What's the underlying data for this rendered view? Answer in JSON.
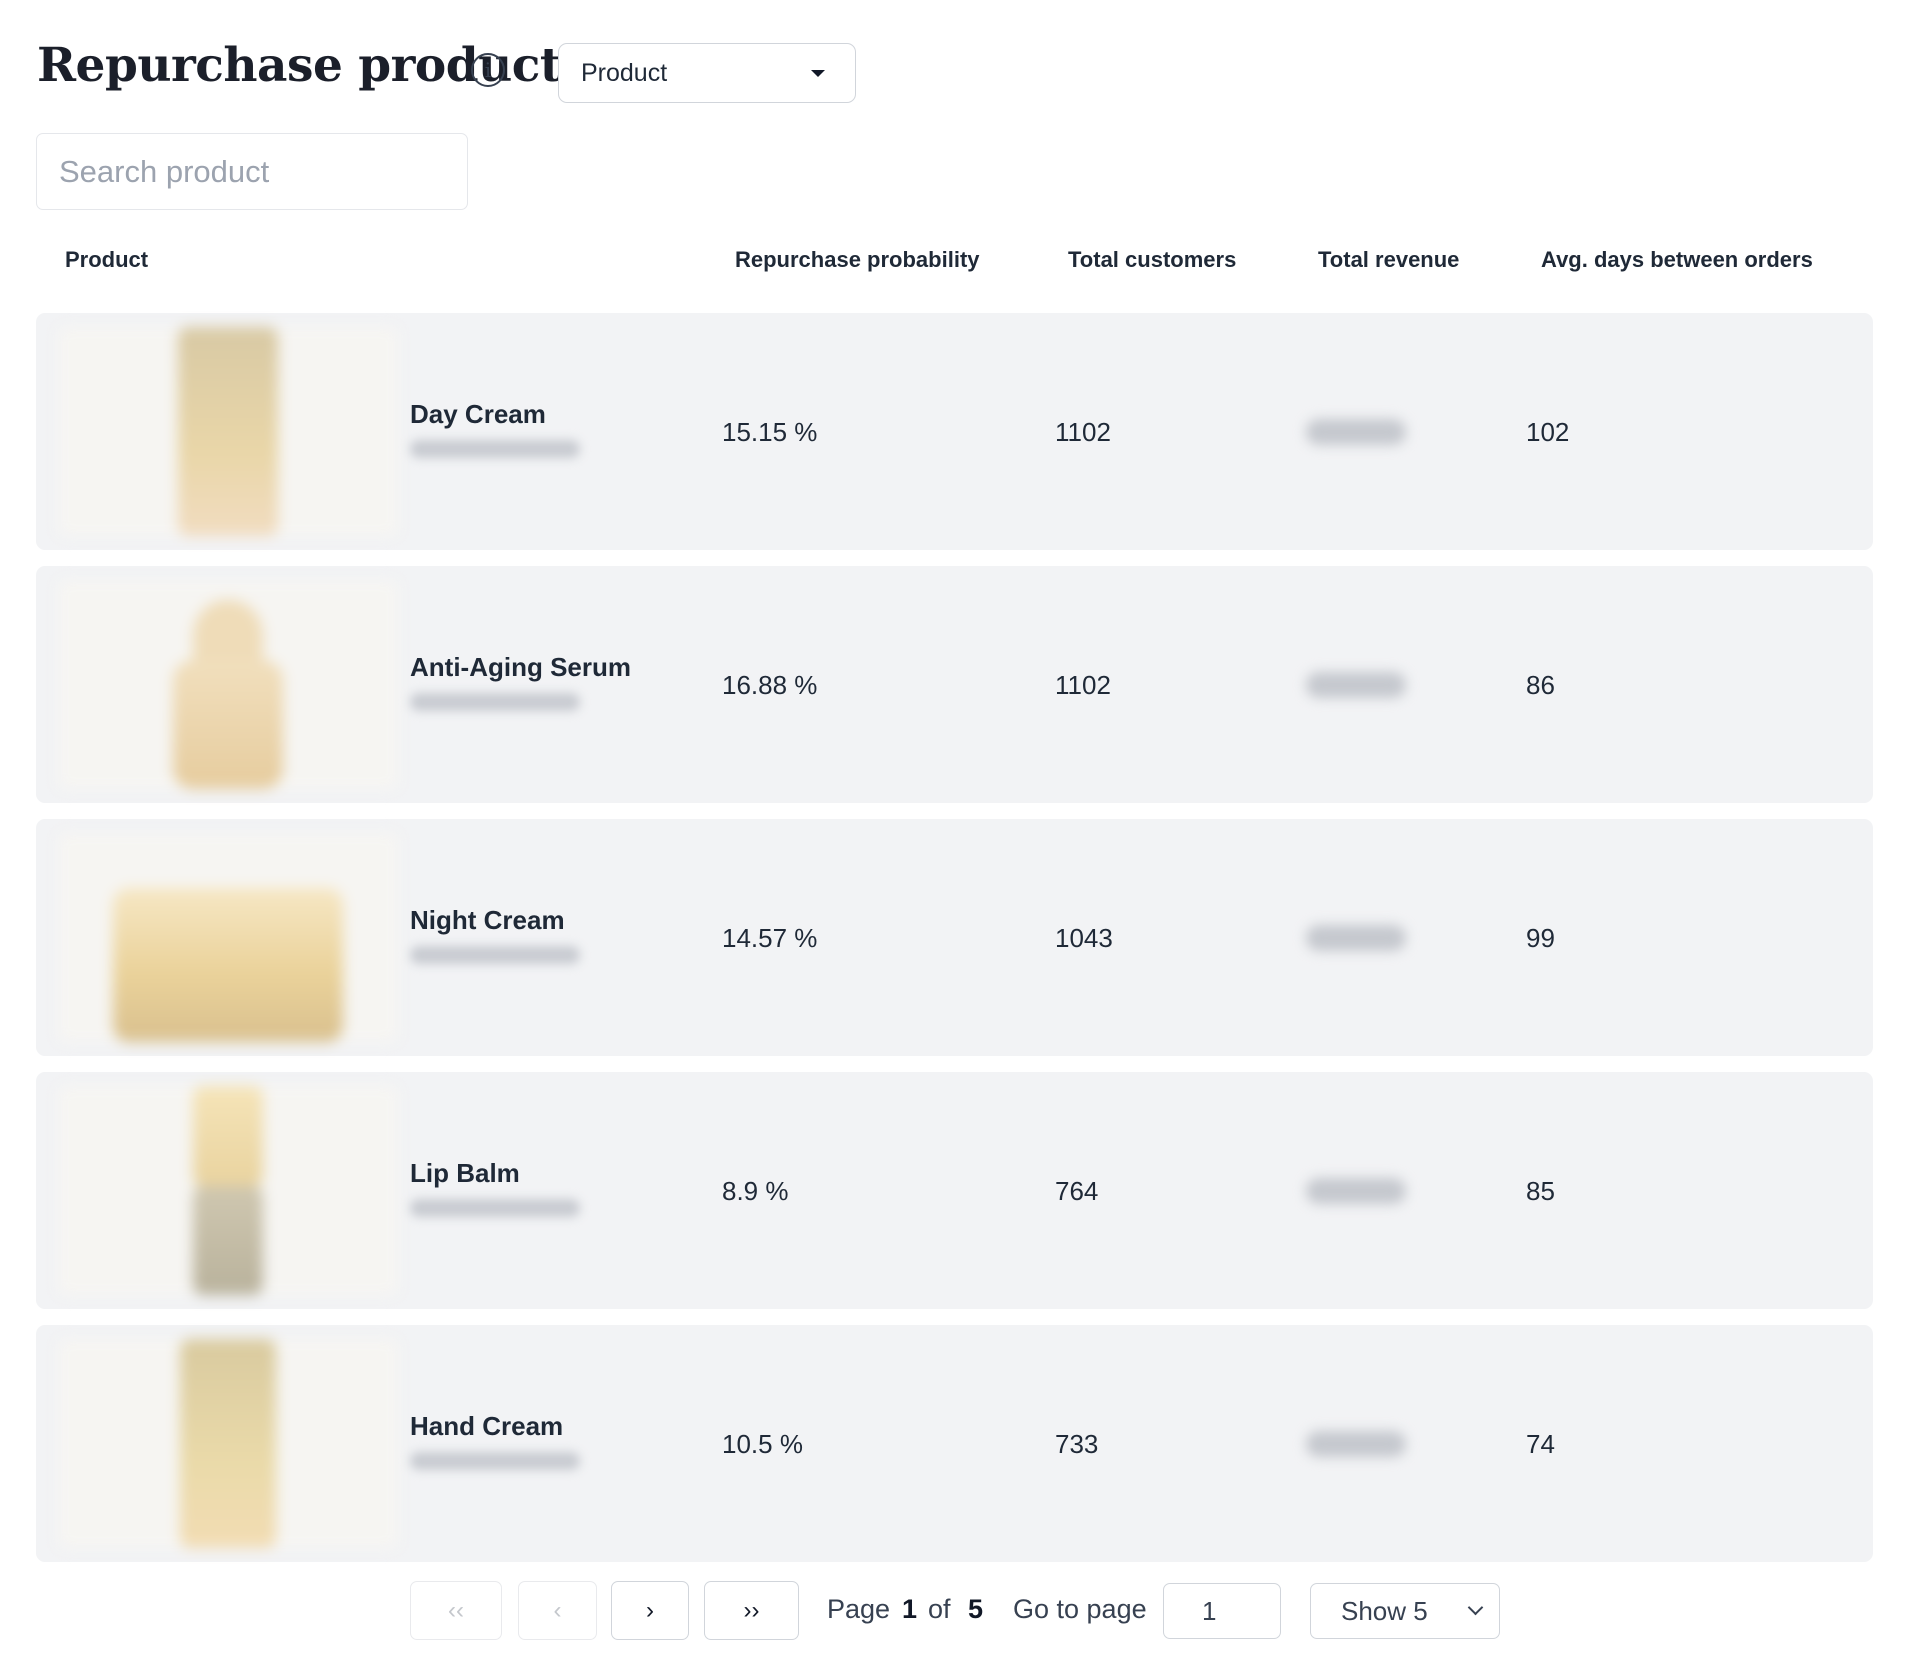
{
  "header": {
    "title": "Repurchase product",
    "info_icon_glyph": "i",
    "dropdown_value": "Product"
  },
  "search": {
    "placeholder": "Search product",
    "value": ""
  },
  "table": {
    "columns": {
      "product": "Product",
      "probability": "Repurchase probability",
      "customers": "Total customers",
      "revenue": "Total revenue",
      "avg_days": "Avg. days between orders"
    },
    "rows": [
      {
        "name": "Day Cream",
        "probability": "15.15 %",
        "customers": "1102",
        "avg_days": "102",
        "thumb_icon": "cream-tube-image"
      },
      {
        "name": "Anti-Aging Serum",
        "probability": "16.88 %",
        "customers": "1102",
        "avg_days": "86",
        "thumb_icon": "serum-bottle-image"
      },
      {
        "name": "Night Cream",
        "probability": "14.57 %",
        "customers": "1043",
        "avg_days": "99",
        "thumb_icon": "cream-jar-image"
      },
      {
        "name": "Lip Balm",
        "probability": "8.9 %",
        "customers": "764",
        "avg_days": "85",
        "thumb_icon": "lip-balm-image"
      },
      {
        "name": "Hand Cream",
        "probability": "10.5 %",
        "customers": "733",
        "avg_days": "74",
        "thumb_icon": "hand-cream-tube-image"
      }
    ]
  },
  "pagination": {
    "first_label": "‹‹",
    "prev_label": "‹",
    "next_label": "›",
    "last_label": "››",
    "page_word": "Page",
    "current_page": "1",
    "of_word": "of",
    "total_pages": "5",
    "goto_label": "Go to page",
    "goto_value": "1",
    "show_value": "Show 5"
  },
  "colors": {
    "row_bg": "#f2f3f5",
    "text": "#1f2937",
    "border": "#d1d5db",
    "placeholder": "#9ca3af"
  }
}
